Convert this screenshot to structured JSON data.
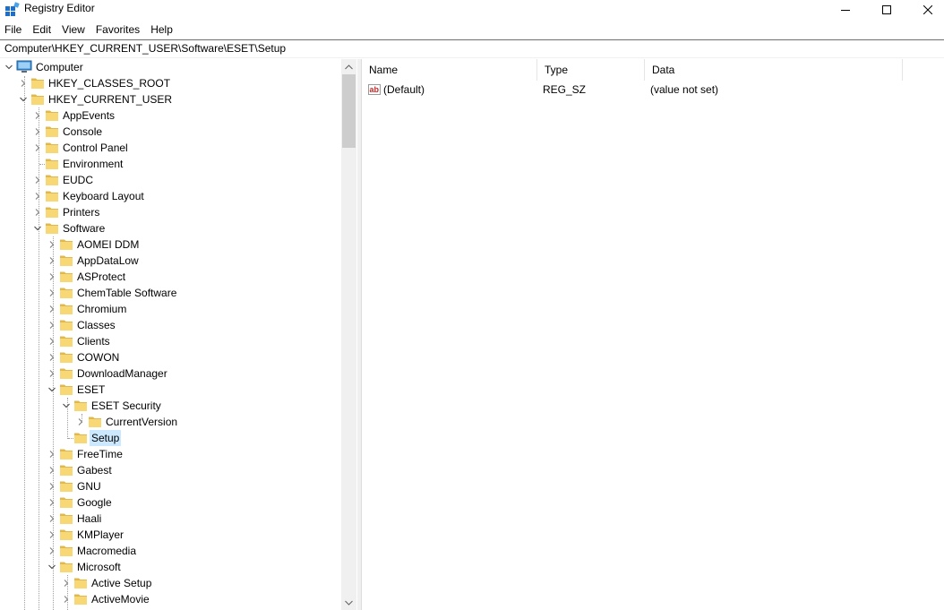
{
  "window": {
    "title": "Registry Editor",
    "icon": "registry-editor-icon"
  },
  "menu": [
    "File",
    "Edit",
    "View",
    "Favorites",
    "Help"
  ],
  "address": "Computer\\HKEY_CURRENT_USER\\Software\\ESET\\Setup",
  "tree": {
    "root": "Computer",
    "nodes": [
      {
        "label": "HKEY_CLASSES_ROOT",
        "state": "collapsed"
      },
      {
        "label": "HKEY_CURRENT_USER",
        "state": "expanded"
      },
      {
        "label": "AppEvents",
        "state": "collapsed"
      },
      {
        "label": "Console",
        "state": "collapsed"
      },
      {
        "label": "Control Panel",
        "state": "collapsed"
      },
      {
        "label": "Environment",
        "state": "leaf"
      },
      {
        "label": "EUDC",
        "state": "collapsed"
      },
      {
        "label": "Keyboard Layout",
        "state": "collapsed"
      },
      {
        "label": "Printers",
        "state": "collapsed"
      },
      {
        "label": "Software",
        "state": "expanded"
      },
      {
        "label": "AOMEI DDM",
        "state": "collapsed"
      },
      {
        "label": "AppDataLow",
        "state": "collapsed"
      },
      {
        "label": "ASProtect",
        "state": "collapsed"
      },
      {
        "label": "ChemTable Software",
        "state": "collapsed"
      },
      {
        "label": "Chromium",
        "state": "collapsed"
      },
      {
        "label": "Classes",
        "state": "collapsed"
      },
      {
        "label": "Clients",
        "state": "collapsed"
      },
      {
        "label": "COWON",
        "state": "collapsed"
      },
      {
        "label": "DownloadManager",
        "state": "collapsed"
      },
      {
        "label": "ESET",
        "state": "expanded"
      },
      {
        "label": "ESET Security",
        "state": "expanded"
      },
      {
        "label": "CurrentVersion",
        "state": "collapsed"
      },
      {
        "label": "Setup",
        "state": "leaf",
        "selected": true
      },
      {
        "label": "FreeTime",
        "state": "collapsed"
      },
      {
        "label": "Gabest",
        "state": "collapsed"
      },
      {
        "label": "GNU",
        "state": "collapsed"
      },
      {
        "label": "Google",
        "state": "collapsed"
      },
      {
        "label": "Haali",
        "state": "collapsed"
      },
      {
        "label": "KMPlayer",
        "state": "collapsed"
      },
      {
        "label": "Macromedia",
        "state": "collapsed"
      },
      {
        "label": "Microsoft",
        "state": "expanded"
      },
      {
        "label": "Active Setup",
        "state": "collapsed"
      },
      {
        "label": "ActiveMovie",
        "state": "collapsed"
      }
    ]
  },
  "list": {
    "columns": [
      "Name",
      "Type",
      "Data"
    ],
    "rows": [
      {
        "name": "(Default)",
        "type": "REG_SZ",
        "data": "(value not set)",
        "icon": "string-value-icon"
      }
    ]
  },
  "colors": {
    "selection": "#cce8ff",
    "folder": "#f8d775",
    "folder_dark": "#e0b84c"
  }
}
